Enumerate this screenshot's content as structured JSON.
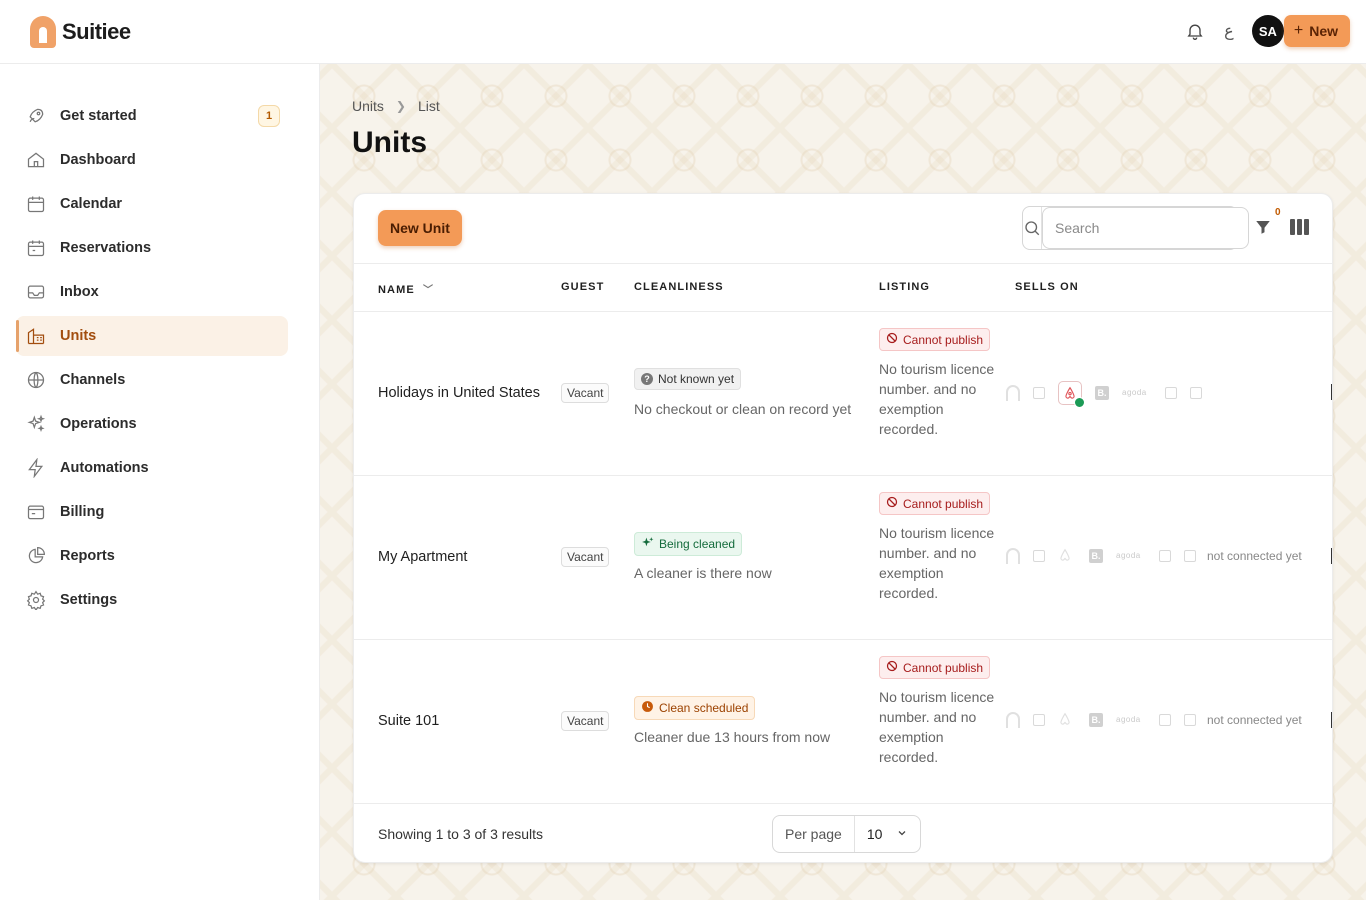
{
  "app": {
    "brand": "Suitiee"
  },
  "topbar": {
    "lang_glyph": "ع",
    "avatar_initials": "SA",
    "new_label": "New"
  },
  "sidebar": {
    "items": [
      {
        "label": "Get started",
        "badge": "1",
        "icon": "rocket-icon"
      },
      {
        "label": "Dashboard",
        "icon": "home-icon"
      },
      {
        "label": "Calendar",
        "icon": "calendar-icon"
      },
      {
        "label": "Reservations",
        "icon": "reservations-icon"
      },
      {
        "label": "Inbox",
        "icon": "inbox-icon"
      },
      {
        "label": "Units",
        "icon": "units-icon",
        "active": true
      },
      {
        "label": "Channels",
        "icon": "globe-icon"
      },
      {
        "label": "Operations",
        "icon": "sparkles-icon"
      },
      {
        "label": "Automations",
        "icon": "bolt-icon"
      },
      {
        "label": "Billing",
        "icon": "billing-icon"
      },
      {
        "label": "Reports",
        "icon": "pie-chart-icon"
      },
      {
        "label": "Settings",
        "icon": "gear-icon"
      }
    ]
  },
  "breadcrumb": {
    "root": "Units",
    "current": "List"
  },
  "page": {
    "title": "Units"
  },
  "toolbar": {
    "new_unit_label": "New Unit",
    "search_placeholder": "Search",
    "filter_count": "0"
  },
  "table": {
    "headers": {
      "name": "NAME",
      "guest": "GUEST",
      "cleanliness": "CLEANLINESS",
      "listing": "LISTING",
      "sells_on": "SELLS ON"
    },
    "rows": [
      {
        "name": "Holidays in United States",
        "guest": "Vacant",
        "clean_status": "Not known yet",
        "clean_detail": "No checkout or clean on record yet",
        "listing_status": "Cannot publish",
        "listing_detail": "No tourism licence number. and no exemption recorded.",
        "connection": ""
      },
      {
        "name": "My Apartment",
        "guest": "Vacant",
        "clean_status": "Being cleaned",
        "clean_detail": "A cleaner is there now",
        "listing_status": "Cannot publish",
        "listing_detail": "No tourism licence number. and no exemption recorded.",
        "connection": "not connected yet"
      },
      {
        "name": "Suite 101",
        "guest": "Vacant",
        "clean_status": "Clean scheduled",
        "clean_detail": "Cleaner due 13 hours from now",
        "listing_status": "Cannot publish",
        "listing_detail": "No tourism licence number. and no exemption recorded.",
        "connection": "not connected yet"
      }
    ]
  },
  "channel_logos": {
    "b": "B.",
    "agoda": "agoda"
  },
  "footer": {
    "results": "Showing 1 to 3 of 3 results",
    "per_page_label": "Per page",
    "per_page_value": "10"
  },
  "colors": {
    "accent": "#f39a57",
    "active_bg": "#fbf1e6",
    "danger": "#a61c1c",
    "success": "#146b3c"
  }
}
